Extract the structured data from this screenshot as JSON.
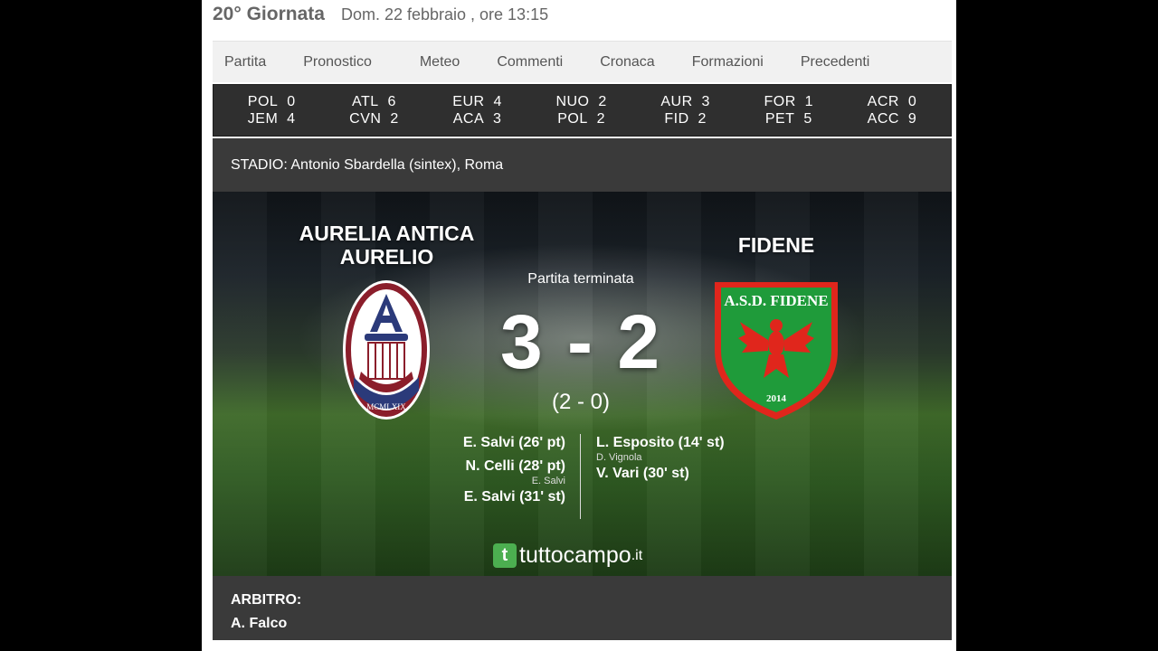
{
  "header": {
    "round": "20° Giornata",
    "date": "Dom. 22 febbraio , ore 13:15"
  },
  "tabs": [
    "Partita",
    "Pronostico",
    "Meteo",
    "Commenti",
    "Cronaca",
    "Formazioni",
    "Precedenti"
  ],
  "other_scores": [
    {
      "home": "POL",
      "home_score": "0",
      "away": "JEM",
      "away_score": "4"
    },
    {
      "home": "ATL",
      "home_score": "6",
      "away": "CVN",
      "away_score": "2"
    },
    {
      "home": "EUR",
      "home_score": "4",
      "away": "ACA",
      "away_score": "3"
    },
    {
      "home": "NUO",
      "home_score": "2",
      "away": "POL",
      "away_score": "2"
    },
    {
      "home": "AUR",
      "home_score": "3",
      "away": "FID",
      "away_score": "2"
    },
    {
      "home": "FOR",
      "home_score": "1",
      "away": "PET",
      "away_score": "5"
    },
    {
      "home": "ACR",
      "home_score": "0",
      "away": "ACC",
      "away_score": "9"
    }
  ],
  "stadium": "STADIO: Antonio Sbardella (sintex), Roma",
  "match": {
    "home_team": {
      "line1": "AURELIA ANTICA",
      "line2": "AURELIO",
      "logo_text": "MCMLXIX"
    },
    "away_team": {
      "name": "FIDENE",
      "logo_text": "A.S.D. FIDENE",
      "logo_year": "2014"
    },
    "status": "Partita terminata",
    "score": "3 - 2",
    "halftime": "(2 - 0)",
    "home_scorers": [
      {
        "name": "E. Salvi (26' pt)",
        "assist": ""
      },
      {
        "name": "N. Celli (28' pt)",
        "assist": "E. Salvi"
      },
      {
        "name": "E. Salvi (31' st)",
        "assist": ""
      }
    ],
    "away_scorers": [
      {
        "name": "L. Esposito (14' st)",
        "assist": "D. Vignola"
      },
      {
        "name": "V. Vari (30' st)",
        "assist": ""
      }
    ]
  },
  "brand": {
    "icon": "t",
    "name": "tuttocampo",
    "tld": ".it"
  },
  "referee": {
    "label": "ARBITRO:",
    "name": "A. Falco"
  },
  "colors": {
    "home_primary": "#8b1e2b",
    "home_secondary": "#2b3a7a",
    "away_green": "#1f9b3a",
    "away_red": "#e0261c",
    "brand_green": "#4caf50"
  }
}
